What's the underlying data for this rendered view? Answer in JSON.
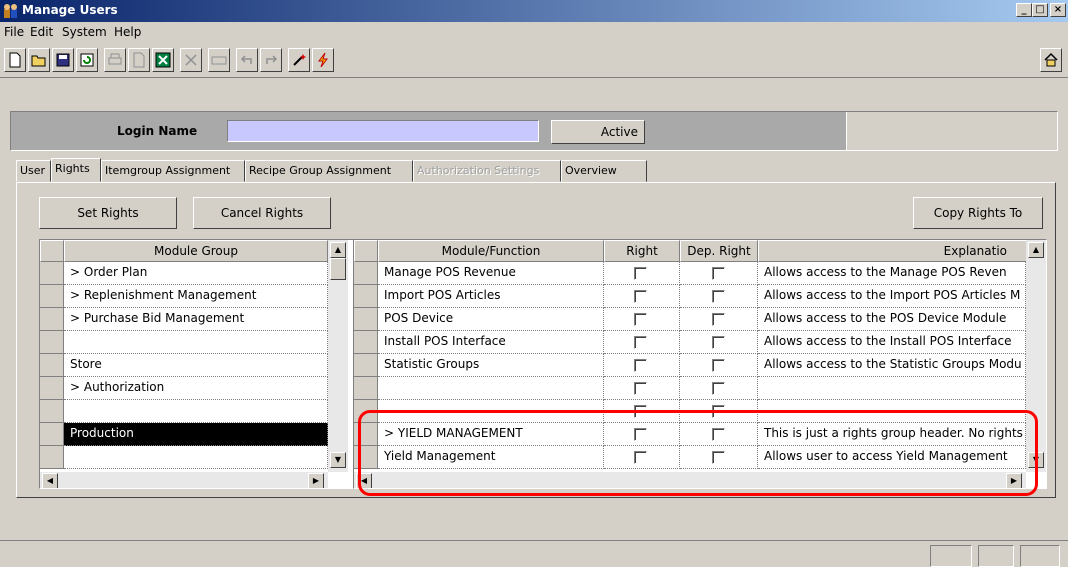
{
  "window": {
    "title": "Manage Users",
    "minimize": "_",
    "maximize": "□",
    "close": "×"
  },
  "menu": [
    "File",
    "Edit",
    "System",
    "Help"
  ],
  "toolbar": {
    "icons": [
      "new-icon",
      "open-icon",
      "save-icon",
      "refresh-icon",
      "print-icon",
      "print-preview-icon",
      "export-excel-icon",
      "cut-icon",
      "abc-icon",
      "undo-icon",
      "redo-icon",
      "wand-icon",
      "lightning-icon",
      "home-icon"
    ]
  },
  "login": {
    "label": "Login Name",
    "value": "",
    "active_label": "Active"
  },
  "tabs": [
    {
      "label": "User",
      "state": "normal"
    },
    {
      "label": "Rights",
      "state": "active"
    },
    {
      "label": "Itemgroup Assignment",
      "state": "normal"
    },
    {
      "label": "Recipe Group Assignment",
      "state": "normal"
    },
    {
      "label": "Authorization Settings",
      "state": "disabled"
    },
    {
      "label": "Overview",
      "state": "normal"
    }
  ],
  "buttons": {
    "set_rights": "Set Rights",
    "cancel_rights": "Cancel Rights",
    "copy_rights": "Copy Rights To"
  },
  "module_grid": {
    "header": "Module Group",
    "rows": [
      "> Order Plan",
      "> Replenishment Management",
      "> Purchase Bid Management",
      "",
      "Store",
      "> Authorization",
      "",
      "Production",
      ""
    ],
    "selected_row": 7
  },
  "function_grid": {
    "headers": [
      "Module/Function",
      "Right",
      "Dep. Right",
      "Explanatio"
    ],
    "rows": [
      {
        "name": "Manage POS Revenue",
        "explanation": "Allows access to the Manage POS Reven"
      },
      {
        "name": "Import POS Articles",
        "explanation": "Allows access to the Import POS Articles M"
      },
      {
        "name": "POS Device",
        "explanation": "Allows access to the POS Device Module"
      },
      {
        "name": "Install POS Interface",
        "explanation": "Allows access to the Install POS Interface"
      },
      {
        "name": "Statistic Groups",
        "explanation": "Allows access to the Statistic Groups Modu"
      },
      {
        "name": "",
        "explanation": ""
      },
      {
        "name": "",
        "explanation": ""
      },
      {
        "name": "> YIELD MANAGEMENT",
        "explanation": "This is just a rights group header. No rights"
      },
      {
        "name": "Yield Management",
        "explanation": "Allows user to access Yield Management"
      }
    ]
  },
  "colors": {
    "highlight": "#ff0000",
    "title_gradient_start": "#0a246a",
    "login_panel": "#a9a9a9",
    "login_field": "#c8c8ff"
  }
}
